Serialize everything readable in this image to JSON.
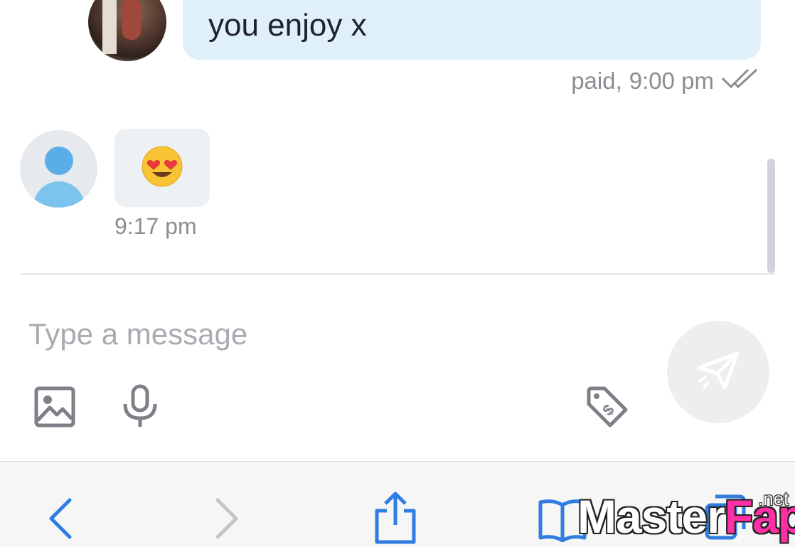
{
  "conversation": {
    "sent_message": {
      "text": "you enjoy x",
      "status": "paid,",
      "time": "9:00 pm",
      "read_icon": "double-check-icon"
    },
    "received_message": {
      "emoji": "😍",
      "time": "9:17 pm",
      "avatar_icon": "default-user-icon"
    }
  },
  "composer": {
    "placeholder": "Type a message",
    "tools": [
      "image-icon",
      "microphone-icon",
      "price-tag-dollar-icon"
    ],
    "send_icon": "paper-plane-icon"
  },
  "browser_toolbar": {
    "buttons": [
      "back-icon",
      "forward-icon",
      "share-icon",
      "bookmarks-icon",
      "tabs-icon"
    ]
  },
  "watermark": {
    "part1": "Master",
    "part2": "Fap",
    "suffix": ".net"
  },
  "colors": {
    "sent_bubble": "#dff0fb",
    "received_bubble": "#eef1f4",
    "ios_blue": "#2f7de1",
    "icon_gray": "#7d8087",
    "meta_gray": "#8a8d92"
  }
}
